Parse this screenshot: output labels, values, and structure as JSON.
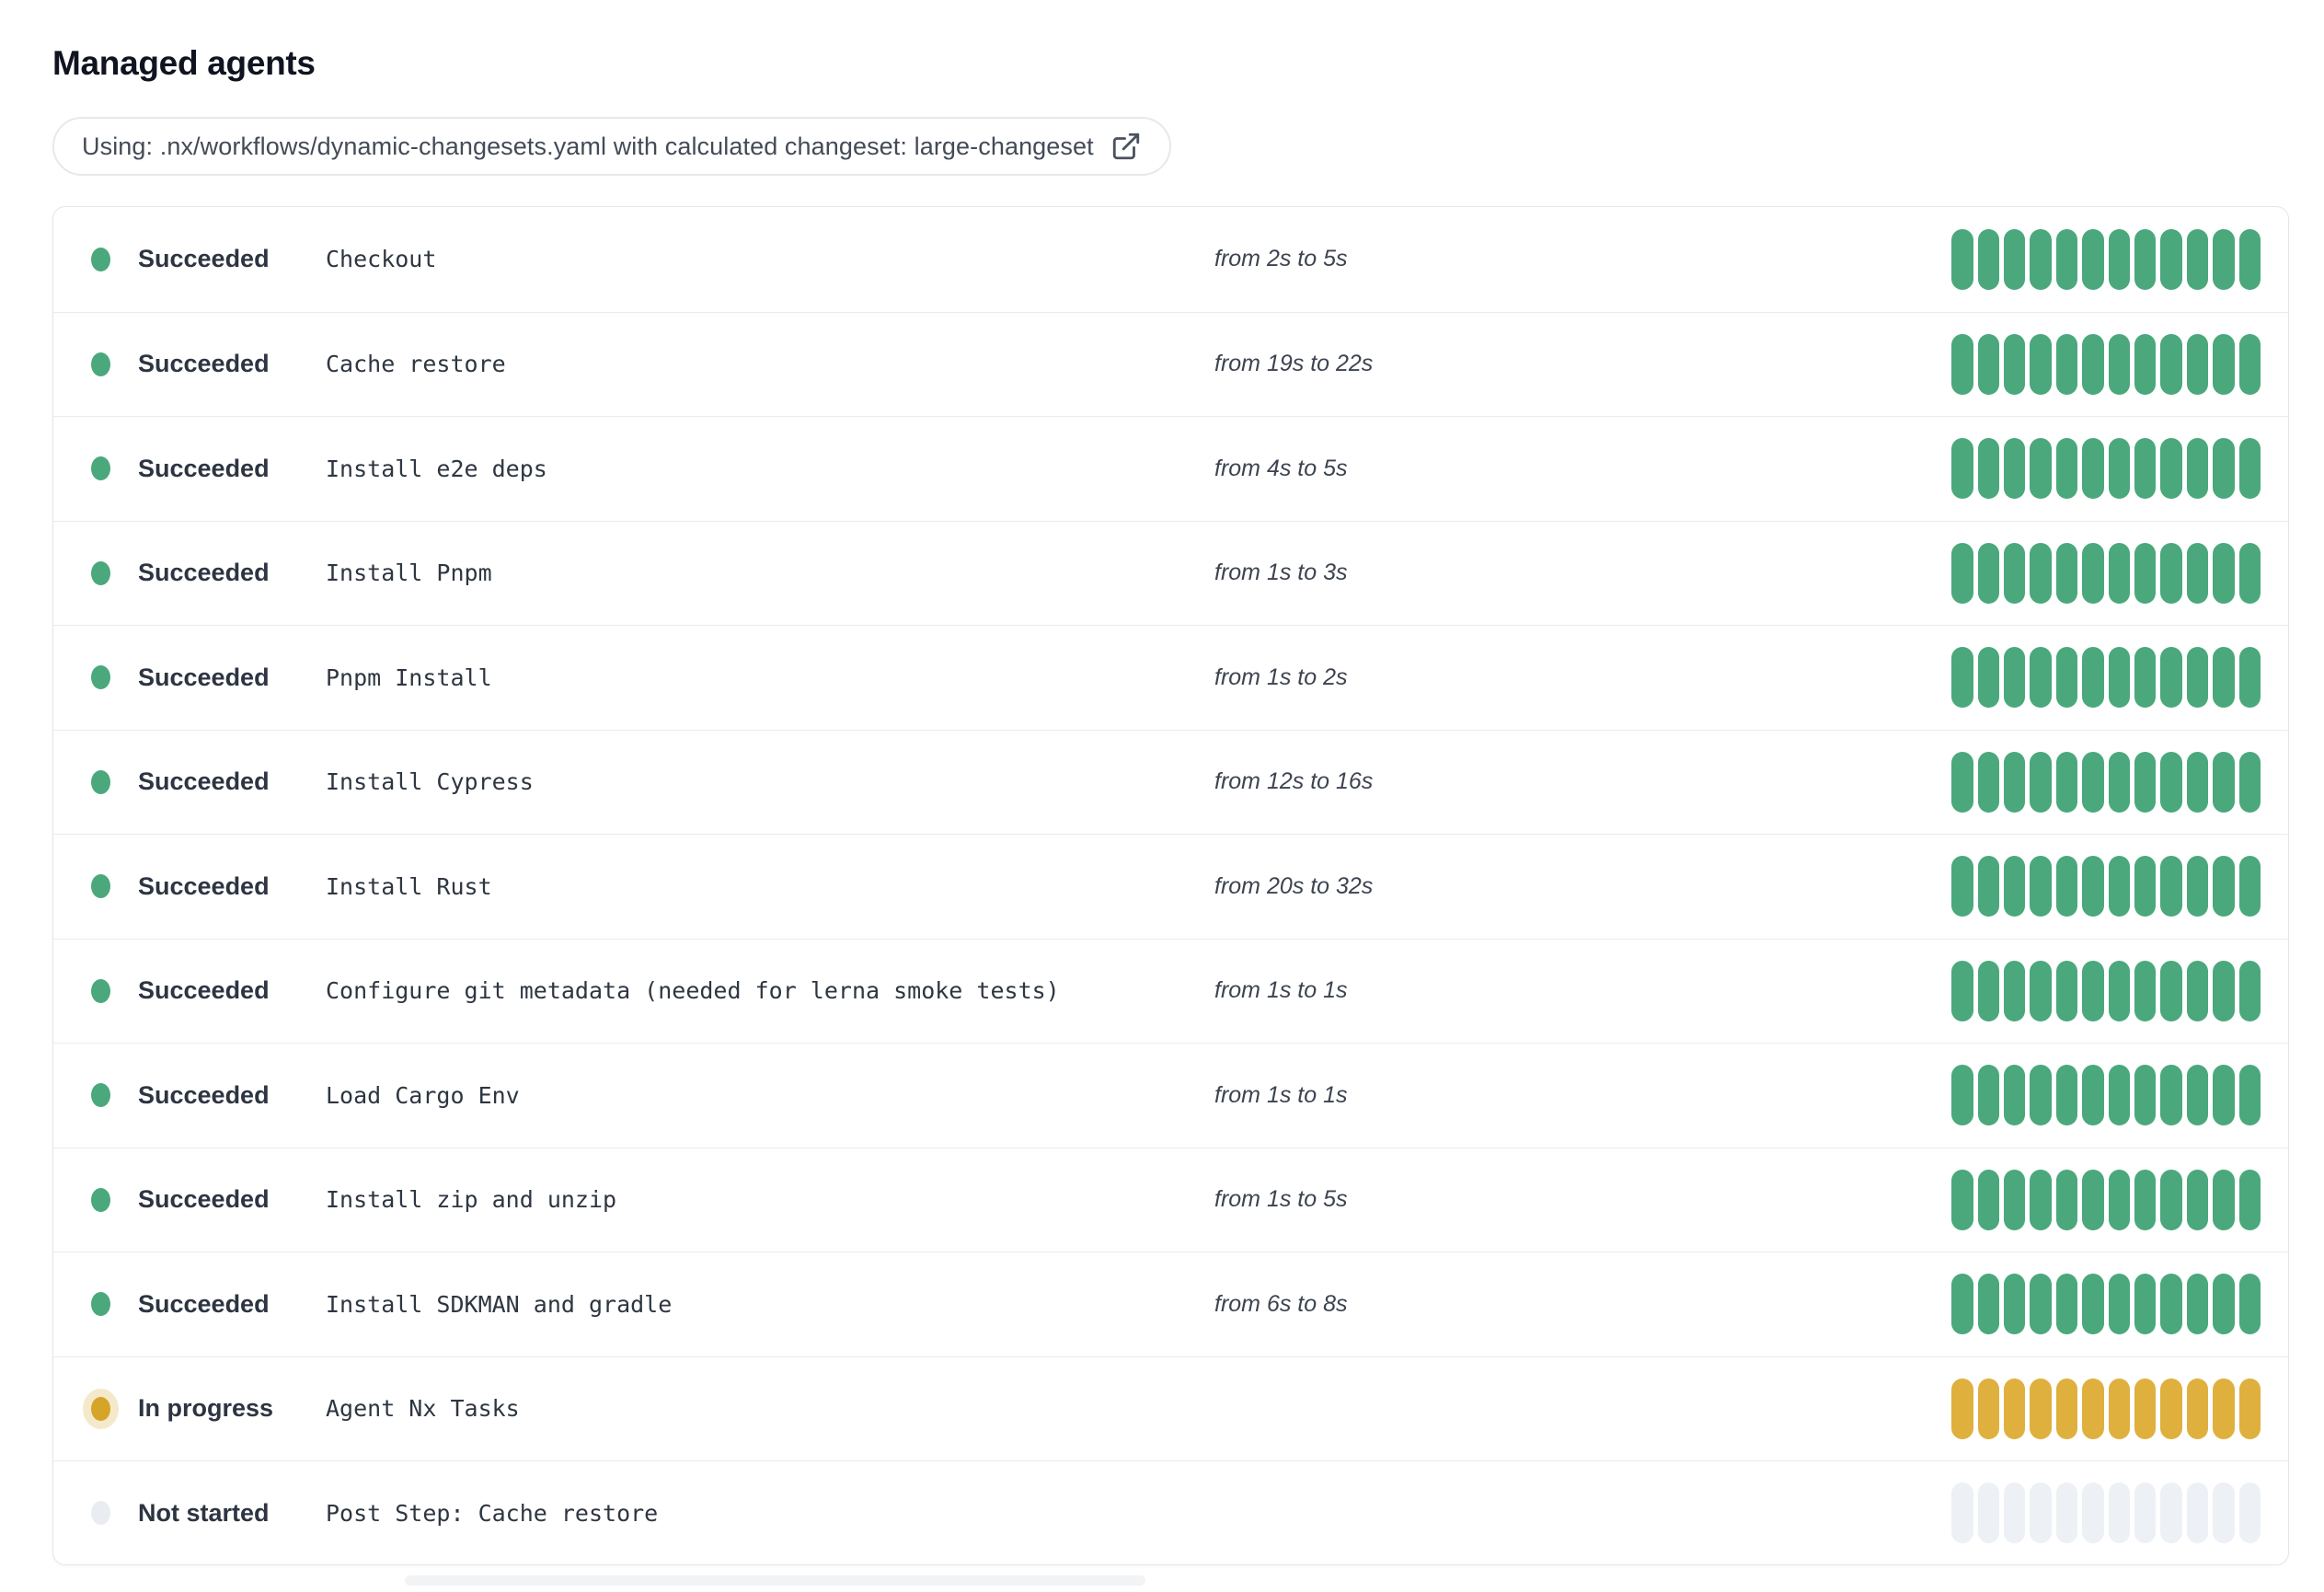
{
  "title": "Managed agents",
  "chip": {
    "label": "Using: .nx/workflows/dynamic-changesets.yaml with calculated changeset: large-changeset",
    "icon": "external-link-icon"
  },
  "bar": {
    "segments": 12
  },
  "colors": {
    "succeeded": "#4aa87c",
    "in_progress": "#dfb03d",
    "not_started": "#edf0f5",
    "succeeded_dot": "#4aa87c",
    "in_progress_dot": "#d6a428",
    "in_progress_halo": "#f5e9cb",
    "not_started_dot": "#e9edf2"
  },
  "rows": [
    {
      "status": "succeeded",
      "status_label": "Succeeded",
      "name": "Checkout",
      "duration": "from 2s to 5s"
    },
    {
      "status": "succeeded",
      "status_label": "Succeeded",
      "name": "Cache restore",
      "duration": "from 19s to 22s"
    },
    {
      "status": "succeeded",
      "status_label": "Succeeded",
      "name": "Install e2e deps",
      "duration": "from 4s to 5s"
    },
    {
      "status": "succeeded",
      "status_label": "Succeeded",
      "name": "Install Pnpm",
      "duration": "from 1s to 3s"
    },
    {
      "status": "succeeded",
      "status_label": "Succeeded",
      "name": "Pnpm Install",
      "duration": "from 1s to 2s"
    },
    {
      "status": "succeeded",
      "status_label": "Succeeded",
      "name": "Install Cypress",
      "duration": "from 12s to 16s"
    },
    {
      "status": "succeeded",
      "status_label": "Succeeded",
      "name": "Install Rust",
      "duration": "from 20s to 32s"
    },
    {
      "status": "succeeded",
      "status_label": "Succeeded",
      "name": "Configure git metadata (needed for lerna smoke tests)",
      "duration": "from 1s to 1s"
    },
    {
      "status": "succeeded",
      "status_label": "Succeeded",
      "name": "Load Cargo Env",
      "duration": "from 1s to 1s"
    },
    {
      "status": "succeeded",
      "status_label": "Succeeded",
      "name": "Install zip and unzip",
      "duration": "from 1s to 5s"
    },
    {
      "status": "succeeded",
      "status_label": "Succeeded",
      "name": "Install SDKMAN and gradle",
      "duration": "from 6s to 8s"
    },
    {
      "status": "in-progress",
      "status_label": "In progress",
      "name": "Agent Nx Tasks",
      "duration": ""
    },
    {
      "status": "not-started",
      "status_label": "Not started",
      "name": "Post Step: Cache restore",
      "duration": ""
    }
  ]
}
